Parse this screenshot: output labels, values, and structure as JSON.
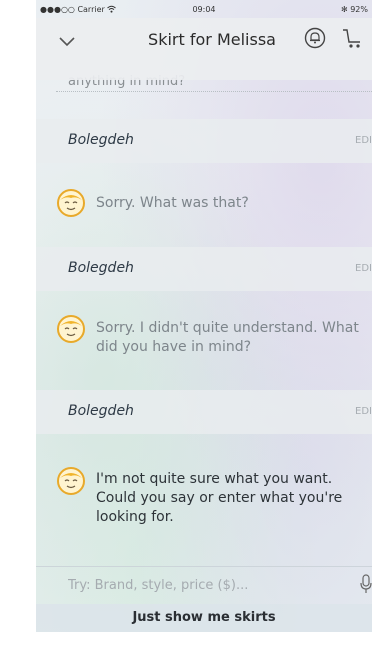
{
  "status_bar": {
    "carrier": "●●●○○ Carrier",
    "wifi_icon": "wifi-icon",
    "time": "09:04",
    "bluetooth_icon": "bluetooth-icon",
    "battery": "92%"
  },
  "nav": {
    "back_icon": "chevron-down-icon",
    "title": "Skirt for Melissa",
    "bell_icon": "bell-icon",
    "cart_icon": "cart-icon"
  },
  "conversation": {
    "previous_line": "anything in mind?",
    "user_entries": [
      {
        "name": "Bolegdeh",
        "edit": "EDI"
      },
      {
        "name": "Bolegdeh",
        "edit": "EDI"
      },
      {
        "name": "Bolegdeh",
        "edit": "EDI"
      }
    ],
    "bot_messages": [
      {
        "text": "Sorry. What was that?"
      },
      {
        "text": "Sorry. I didn't quite understand. What did you have in mind?"
      },
      {
        "text": "I'm not quite sure what you want. Could you say or enter what you're looking for."
      }
    ]
  },
  "input": {
    "placeholder": "Try: Brand, style, price ($)...",
    "value": "",
    "mic_icon": "microphone-icon"
  },
  "actions": {
    "show_skirts_label": "Just show me skirts"
  },
  "colors": {
    "bot_avatar_face": "#fff3c9",
    "bot_avatar_hair": "#f0b42c",
    "user_text": "#2e3a46"
  }
}
